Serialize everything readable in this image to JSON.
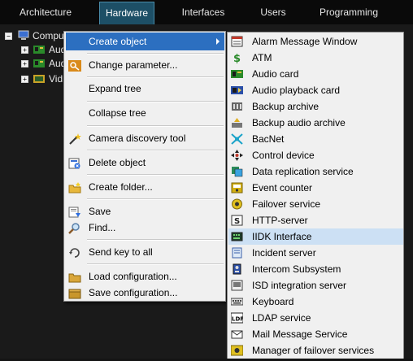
{
  "tabs": [
    {
      "label": "Architecture",
      "active": false
    },
    {
      "label": "Hardware",
      "active": true
    },
    {
      "label": "Interfaces",
      "active": false
    },
    {
      "label": "Users",
      "active": false
    },
    {
      "label": "Programming",
      "active": false
    }
  ],
  "tree": {
    "root_label": "Compu",
    "children": [
      "Aud",
      "Aud",
      "Vid"
    ]
  },
  "menu": {
    "items": [
      {
        "label": "Create object",
        "icon": "none",
        "highlight": true,
        "submenu": true
      },
      {
        "label": "Change parameter...",
        "icon": "key-icon"
      },
      {
        "label": "Expand tree",
        "icon": "none"
      },
      {
        "label": "Collapse tree",
        "icon": "none"
      },
      {
        "label": "Camera discovery tool",
        "icon": "wand-icon"
      },
      {
        "label": "Delete object",
        "icon": "delete-icon"
      },
      {
        "label": "Create folder...",
        "icon": "new-folder-icon"
      },
      {
        "label": "Save",
        "icon": "save-icon"
      },
      {
        "label": "Find...",
        "icon": "magnifier-icon"
      },
      {
        "label": "Send key to all",
        "icon": "refresh-icon"
      },
      {
        "label": "Load configuration...",
        "icon": "folder-icon"
      },
      {
        "label": "Save configuration...",
        "icon": "box-icon"
      }
    ]
  },
  "submenu": {
    "items": [
      {
        "label": "Alarm Message Window",
        "icon": "alarm-window-icon"
      },
      {
        "label": "ATM",
        "icon": "dollar-icon"
      },
      {
        "label": "Audio card",
        "icon": "audio-card-icon"
      },
      {
        "label": "Audio playback card",
        "icon": "audio-playback-icon"
      },
      {
        "label": "Backup archive",
        "icon": "backup-archive-icon"
      },
      {
        "label": "Backup audio archive",
        "icon": "backup-audio-icon"
      },
      {
        "label": "BacNet",
        "icon": "bacnet-icon"
      },
      {
        "label": "Control device",
        "icon": "control-device-icon"
      },
      {
        "label": "Data replication service",
        "icon": "replication-icon"
      },
      {
        "label": "Event counter",
        "icon": "event-counter-icon"
      },
      {
        "label": "Failover service",
        "icon": "failover-icon"
      },
      {
        "label": "HTTP-server",
        "icon": "http-server-icon"
      },
      {
        "label": "IIDK Interface",
        "icon": "iidk-icon",
        "hover": true
      },
      {
        "label": "Incident server",
        "icon": "incident-icon"
      },
      {
        "label": "Intercom Subsystem",
        "icon": "intercom-icon"
      },
      {
        "label": "ISD integration server",
        "icon": "isd-icon"
      },
      {
        "label": "Keyboard",
        "icon": "keyboard-icon"
      },
      {
        "label": "LDAP service",
        "icon": "ldap-icon"
      },
      {
        "label": "Mail Message Service",
        "icon": "mail-icon"
      },
      {
        "label": "Manager of failover services",
        "icon": "failover-manager-icon"
      }
    ]
  },
  "colors": {
    "highlight": "#2c6fc0",
    "hover": "#cce0f4",
    "active_tab": "#1d4f66"
  }
}
